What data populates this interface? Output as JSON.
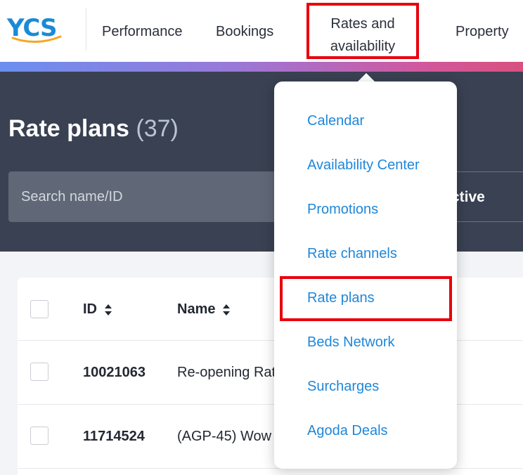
{
  "nav": {
    "logo": "YCS",
    "items": [
      {
        "label": "Performance"
      },
      {
        "label": "Bookings"
      },
      {
        "label_line1": "Rates and",
        "label_line2": "availability"
      },
      {
        "label": "Property"
      }
    ]
  },
  "header": {
    "title": "Rate plans",
    "count": "(37)",
    "search_placeholder": "Search name/ID",
    "filter_label": "ctive"
  },
  "table": {
    "columns": [
      {
        "label": "ID"
      },
      {
        "label": "Name"
      }
    ],
    "rows": [
      {
        "id": "10021063",
        "name": "Re-opening Rat"
      },
      {
        "id": "11714524",
        "name": "(AGP-45) Wow"
      }
    ]
  },
  "dropdown": {
    "items": [
      {
        "label": "Calendar"
      },
      {
        "label": "Availability Center"
      },
      {
        "label": "Promotions"
      },
      {
        "label": "Rate channels"
      },
      {
        "label": "Rate plans"
      },
      {
        "label": "Beds Network"
      },
      {
        "label": "Surcharges"
      },
      {
        "label": "Agoda Deals"
      }
    ]
  },
  "colors": {
    "brand_blue": "#1a8ad8",
    "logo_swoosh": "#f5a623",
    "link_blue": "#1f87d9",
    "highlight_red": "#e8000c",
    "header_dark": "#394152"
  }
}
